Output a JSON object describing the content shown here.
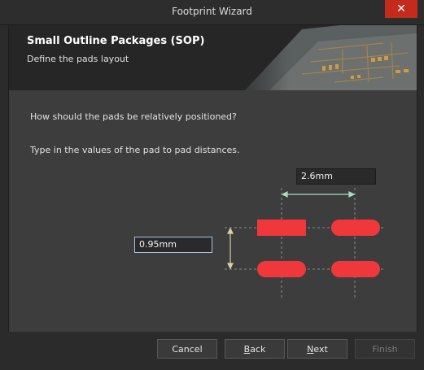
{
  "window": {
    "title": "Footprint Wizard",
    "close_glyph": "✕"
  },
  "banner": {
    "title": "Small Outline Packages (SOP)",
    "subtitle": "Define the pads layout"
  },
  "content": {
    "question1": "How should the pads be relatively positioned?",
    "question2": "Type in the values of the pad to pad distances."
  },
  "fields": {
    "horizontal_distance": "2.6mm",
    "vertical_distance": "0.95mm"
  },
  "buttons": {
    "cancel": "Cancel",
    "back_mnemonic": "B",
    "back_rest": "ack",
    "next_mnemonic": "N",
    "next_rest": "ext",
    "finish": "Finish"
  },
  "colors": {
    "pad": "#f0383a",
    "dimension": "#a9dcc4",
    "close": "#c42b1c"
  }
}
